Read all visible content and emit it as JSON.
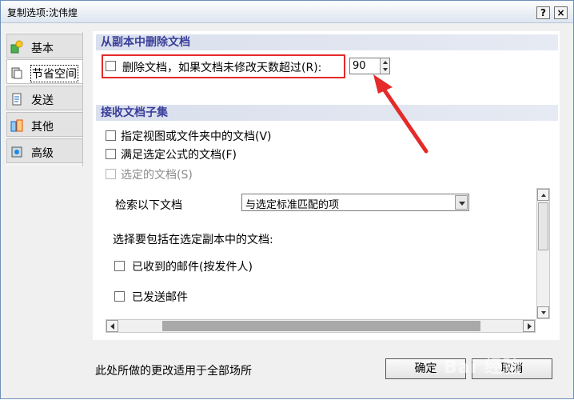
{
  "window": {
    "title": "复制选项:沈伟煌",
    "help_glyph": "?",
    "close_glyph": "×"
  },
  "sidebar": {
    "items": [
      {
        "label": "基本",
        "icon": "basic-icon"
      },
      {
        "label": "节省空间",
        "icon": "space-saver-icon",
        "selected": true
      },
      {
        "label": "发送",
        "icon": "send-icon"
      },
      {
        "label": "其他",
        "icon": "other-icon"
      },
      {
        "label": "高级",
        "icon": "advanced-icon"
      }
    ]
  },
  "section1": {
    "header": "从副本中删除文档",
    "delete_docs": {
      "label": "删除文档，如果文档未修改天数超过(R):",
      "checked": false
    },
    "days_value": "90"
  },
  "section2": {
    "header": "接收文档子集",
    "options": [
      {
        "label": "指定视图或文件夹中的文档(V)",
        "checked": false,
        "enabled": true
      },
      {
        "label": "满足选定公式的文档(F)",
        "checked": false,
        "enabled": true
      },
      {
        "label": "选定的文档(S)",
        "checked": false,
        "enabled": false
      }
    ],
    "retrieve_label": "检索以下文档",
    "retrieve_select": "与选定标准匹配的项",
    "include_label": "选择要包括在选定副本中的文档:",
    "include_options": [
      {
        "label": "已收到的邮件(按发件人)",
        "checked": false
      },
      {
        "label": "已发送邮件",
        "checked": false
      }
    ]
  },
  "footer": {
    "note": "此处所做的更改适用于全部场所",
    "ok_label": "确定",
    "cancel_label": "取消"
  },
  "colors": {
    "accent": "#3a3f9a",
    "highlight": "#e52a2a"
  }
}
